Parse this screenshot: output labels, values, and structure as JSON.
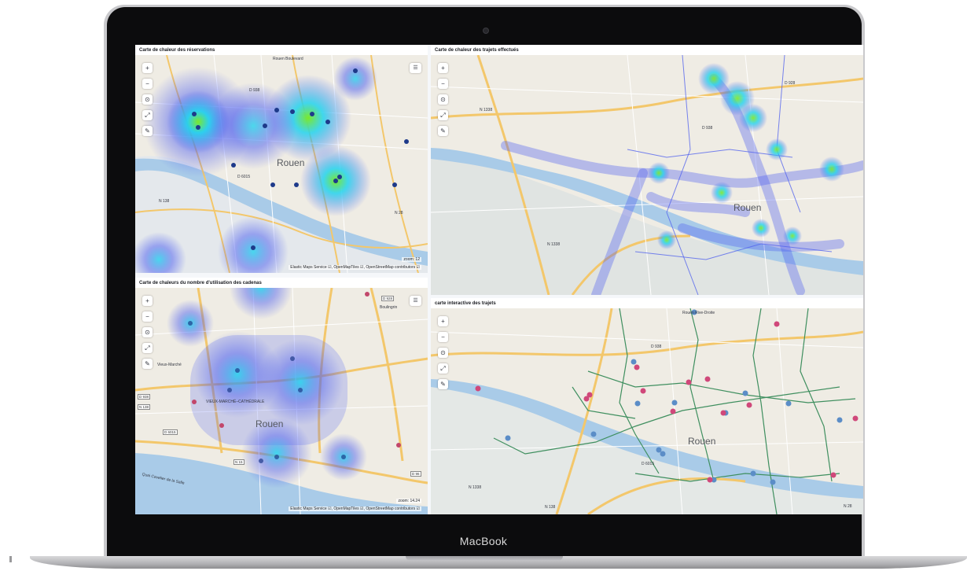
{
  "device": {
    "brand": "MacBook"
  },
  "dashboard": {
    "panels": [
      {
        "title": "Carte de chaleur des réservations",
        "labels": [
          "Rouen",
          "D 938",
          "N 138",
          "N 28",
          "D 6015",
          "Rouen Boulevard"
        ],
        "attribution": "Elastic Maps Service ☑, OpenMapTiles ☑, OpenStreetMap contributors ☑",
        "zoom": "zoom: 12"
      },
      {
        "title": "Carte de chaleur des trajets effectués",
        "labels": [
          "Rouen",
          "N 1338",
          "D 938",
          "N 1338",
          "D 928"
        ],
        "attribution": "",
        "zoom": ""
      },
      {
        "title": "Carte de chaleurs du nombre d'utilisation des cadenas",
        "labels": [
          "Rouen",
          "VIEUX-MARCHÉ–CATHÉDRALE",
          "Vieux-Marché",
          "D 938",
          "N 138",
          "D 6015",
          "N 15",
          "D 928",
          "Boulingrin",
          "D 96",
          "Quai Cavelier de la Salle"
        ],
        "attribution": "Elastic Maps Service ☑, OpenMapTiles ☑, OpenStreetMap contributors ☑",
        "zoom": "zoom: 14.24"
      },
      {
        "title": "carte interactive des trajets",
        "labels": [
          "Rouen",
          "D 938",
          "N 1338",
          "N 138",
          "D 6015",
          "N 28",
          "Rouen Rive-Droite"
        ],
        "attribution": "",
        "zoom": ""
      }
    ],
    "controls": {
      "zoom_in": "+",
      "zoom_out": "−",
      "fit": "⊙",
      "expand": "⤢",
      "draw": "✎",
      "legend": "☰"
    }
  },
  "colors": {
    "heat_low": "#4a5cf0",
    "heat_mid": "#22d3ee",
    "heat_high": "#7ce82a",
    "point_dark": "#1e3a8a",
    "trip_blue": "#5b8dc7",
    "trip_pink": "#d0487a",
    "trip_line": "#3f8f5f",
    "river": "#a9cbe8"
  }
}
